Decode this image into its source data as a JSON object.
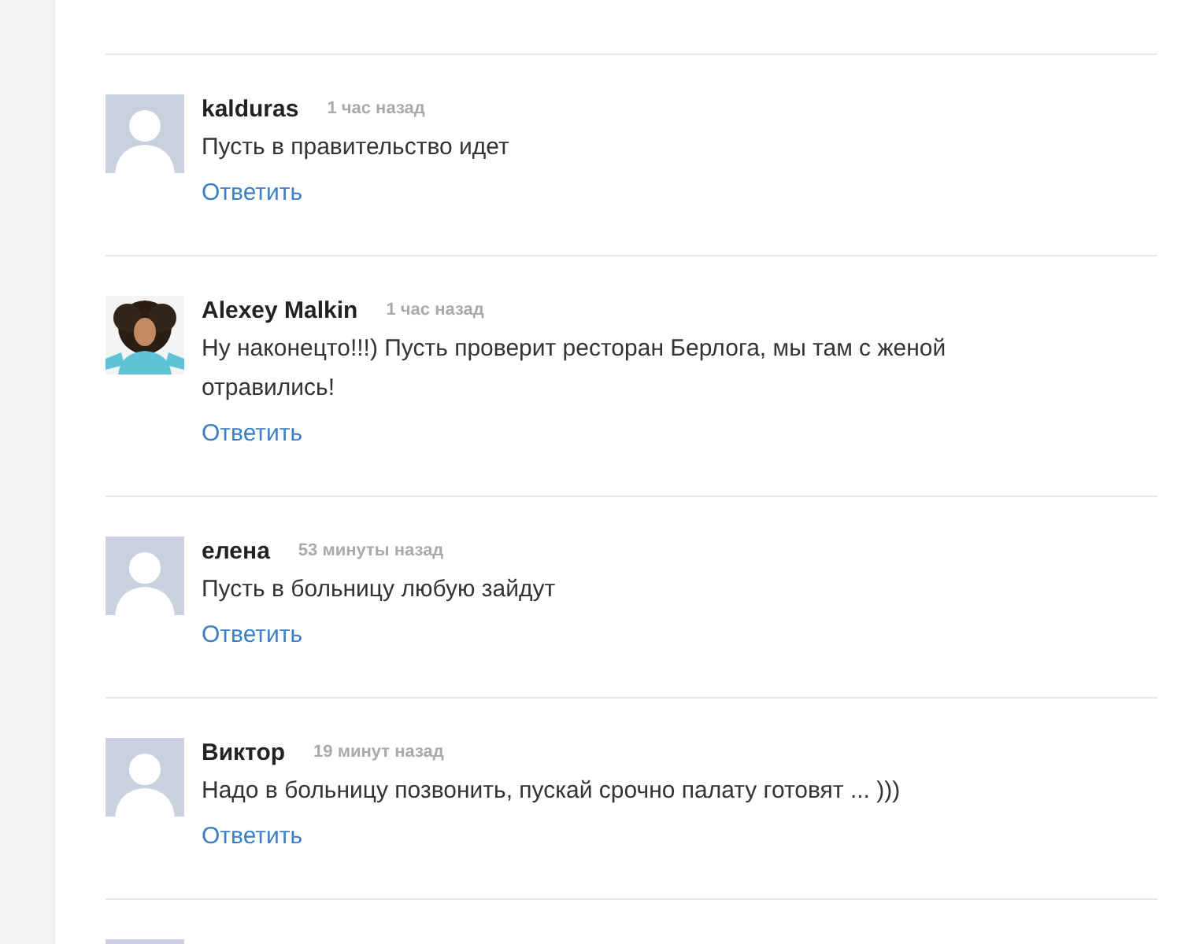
{
  "comments": [
    {
      "kind": "default",
      "author": "kalduras",
      "time": "1 час назад",
      "text": "Пусть в правительство идет",
      "reply": "Ответить"
    },
    {
      "kind": "picture",
      "author": "Alexey Malkin",
      "time": "1 час назад",
      "text": "Ну наконецто!!!) Пусть проверит ресторан Берлога, мы там с женой отравились!",
      "reply": "Ответить"
    },
    {
      "kind": "default",
      "author": "елена",
      "time": "53 минуты назад",
      "text": "Пусть в больницу любую зайдут",
      "reply": "Ответить"
    },
    {
      "kind": "default",
      "author": "Виктор",
      "time": "19 минут назад",
      "text": "Надо в больницу позвонить, пускай срочно палату готовят ... )))",
      "reply": "Ответить"
    },
    {
      "kind": "default"
    }
  ]
}
